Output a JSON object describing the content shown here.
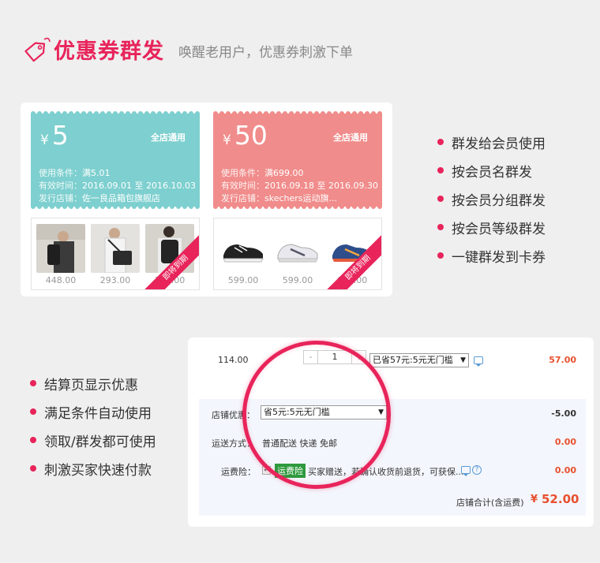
{
  "header": {
    "title": "优惠券群发",
    "subtitle": "唤醒老用户，优惠券刺激下单",
    "tag_text": "优惠",
    "brand_color": "#e8245b"
  },
  "coupons": [
    {
      "yen": "¥",
      "amount": "5",
      "scope": "全店通用",
      "cond_key": "使用条件：",
      "cond_val": "满5.01",
      "period_key": "有效时间：",
      "period_val": "2016.09.01 至 2016.10.03",
      "shop_key": "发行店铺：",
      "shop_val": "佐一良品箱包旗舰店",
      "color": "#7ecfcf",
      "prices": [
        "448.00",
        "293.00",
        "349.00"
      ],
      "ribbon": "即将到期"
    },
    {
      "yen": "¥",
      "amount": "50",
      "scope": "全店通用",
      "cond_key": "使用条件：",
      "cond_val": "满699.00",
      "period_key": "有效时间：",
      "period_val": "2016.09.18 至 2016.09.30",
      "shop_key": "发行店铺：",
      "shop_val": "skechers运动旗...",
      "color": "#f08c8b",
      "prices": [
        "599.00",
        "599.00",
        "699.00"
      ],
      "ribbon": "即将到期"
    }
  ],
  "features_top": [
    "群发给会员使用",
    "按会员名群发",
    "按会员分组群发",
    "按会员等级群发",
    "一键群发到卡券"
  ],
  "features_bottom": [
    "结算页显示优惠",
    "满足条件自动使用",
    "领取/群发都可使用",
    "刺激买家快速付款"
  ],
  "order": {
    "unit_price": "114.00",
    "qty_minus": "-",
    "quantity": "1",
    "qty_plus": "+",
    "item_discount_select": "已省57元:5元无门槛",
    "item_total": "57.00",
    "shop_discount_label": "店铺优惠：",
    "shop_discount_select": "省5元:5元无门槛",
    "shop_discount_amount": "-5.00",
    "shipping_label": "运送方式：",
    "shipping_value": "普通配送 快递 免邮",
    "shipping_amount": "0.00",
    "insurance_label": "运费险：",
    "insurance_badge": "运费险",
    "insurance_text": "买家赠送，若确认收货前退货，可获保...",
    "insurance_amount": "0.00",
    "total_label": "店铺合计(含运费)",
    "total_currency": "¥",
    "total_value": "52.00"
  }
}
